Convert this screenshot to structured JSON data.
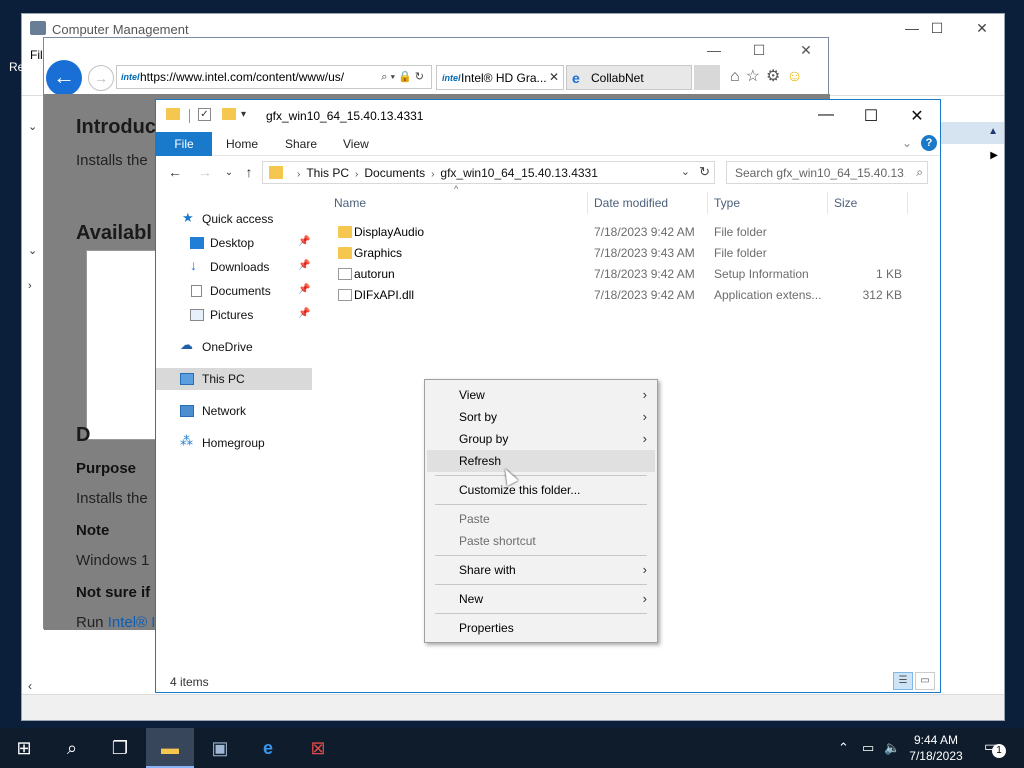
{
  "computer_management": {
    "title": "Computer Management",
    "menu_first": "Fil",
    "side_text": "Re"
  },
  "browser": {
    "url": "https://www.intel.com/content/www/us/",
    "tabs": [
      {
        "label": "Intel® HD Gra...",
        "favicon": "intel-icon"
      },
      {
        "label": "CollabNet",
        "favicon": "ie-icon"
      }
    ],
    "content": {
      "heading_intro": "Introduc",
      "intro_text": "Installs the",
      "heading_available": "Availabl",
      "letter_d": "D",
      "purpose_label": "Purpose",
      "installs_text": "Installs the",
      "note_label": "Note",
      "windows_text": "Windows 1",
      "not_sure_text": "Not sure if",
      "run_text": "Run ",
      "run_link": "Intel® I"
    }
  },
  "explorer": {
    "title_path": "gfx_win10_64_15.40.13.4331",
    "ribbon_tabs": {
      "file": "File",
      "home": "Home",
      "share": "Share",
      "view": "View"
    },
    "breadcrumbs": [
      "This PC",
      "Documents",
      "gfx_win10_64_15.40.13.4331"
    ],
    "search_placeholder": "Search gfx_win10_64_15.40.13....",
    "nav": {
      "quick_access": "Quick access",
      "desktop": "Desktop",
      "downloads": "Downloads",
      "documents": "Documents",
      "pictures": "Pictures",
      "onedrive": "OneDrive",
      "this_pc": "This PC",
      "network": "Network",
      "homegroup": "Homegroup"
    },
    "columns": {
      "name": "Name",
      "date": "Date modified",
      "type": "Type",
      "size": "Size"
    },
    "files": [
      {
        "name": "DisplayAudio",
        "date": "7/18/2023 9:42 AM",
        "type": "File folder",
        "size": ""
      },
      {
        "name": "Graphics",
        "date": "7/18/2023 9:43 AM",
        "type": "File folder",
        "size": ""
      },
      {
        "name": "autorun",
        "date": "7/18/2023 9:42 AM",
        "type": "Setup Information",
        "size": "1 KB"
      },
      {
        "name": "DIFxAPI.dll",
        "date": "7/18/2023 9:42 AM",
        "type": "Application extens...",
        "size": "312 KB"
      }
    ],
    "status": "4 items"
  },
  "context_menu": {
    "view": "View",
    "sort_by": "Sort by",
    "group_by": "Group by",
    "refresh": "Refresh",
    "customize": "Customize this folder...",
    "paste": "Paste",
    "paste_shortcut": "Paste shortcut",
    "share_with": "Share with",
    "new": "New",
    "properties": "Properties"
  },
  "taskbar": {
    "time": "9:44 AM",
    "date": "7/18/2023",
    "notification_count": "1"
  },
  "colors": {
    "accent": "#1979ca",
    "folder": "#f5c74e",
    "taskbar": "#0f1c2c"
  }
}
